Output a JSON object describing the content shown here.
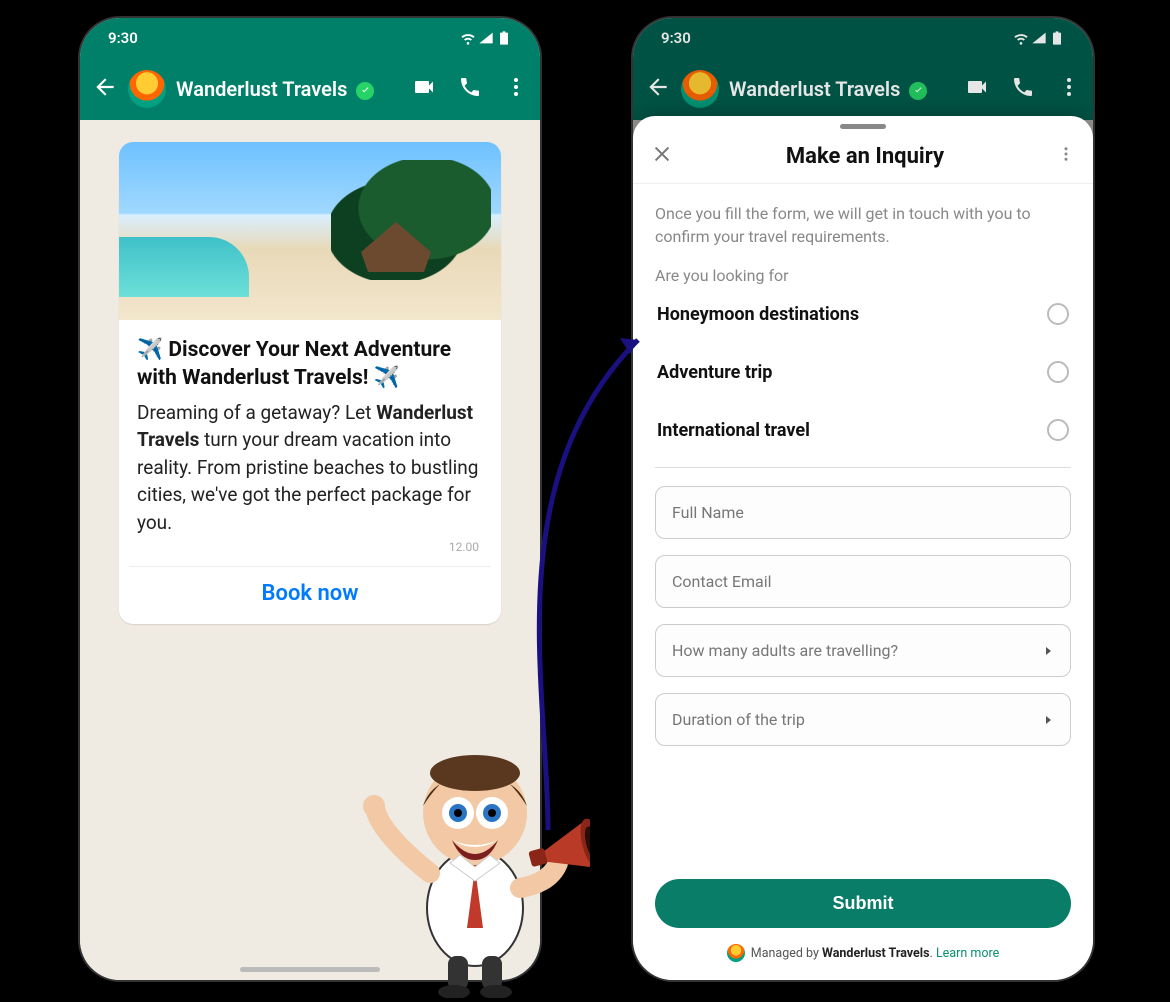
{
  "status": {
    "time": "9:30"
  },
  "chat": {
    "name": "Wanderlust Travels",
    "verified": true
  },
  "message": {
    "title_prefix_emoji": "✈️",
    "title": "Discover Your Next Adventure with Wanderlust Travels!",
    "title_suffix_emoji": "✈️",
    "body_pre": "Dreaming of a getaway? Let ",
    "body_bold": "Wanderlust Travels",
    "body_post": " turn your dream vacation into reality. From pristine beaches to bustling cities, we've got the perfect package for you.",
    "time": "12.00",
    "cta": "Book now"
  },
  "sheet": {
    "title": "Make an Inquiry",
    "description": "Once you fill the form, we will get in touch with you to confirm your travel requirements.",
    "question": "Are you looking for",
    "options": [
      "Honeymoon destinations",
      "Adventure trip",
      "International travel"
    ],
    "fields": {
      "full_name": "Full Name",
      "email": "Contact Email",
      "adults": "How many adults are travelling?",
      "duration": "Duration of the trip"
    },
    "submit": "Submit",
    "managed_pre": "Managed by ",
    "managed_by": "Wanderlust Travels",
    "managed_sep": ". ",
    "learn_more": "Learn more"
  }
}
